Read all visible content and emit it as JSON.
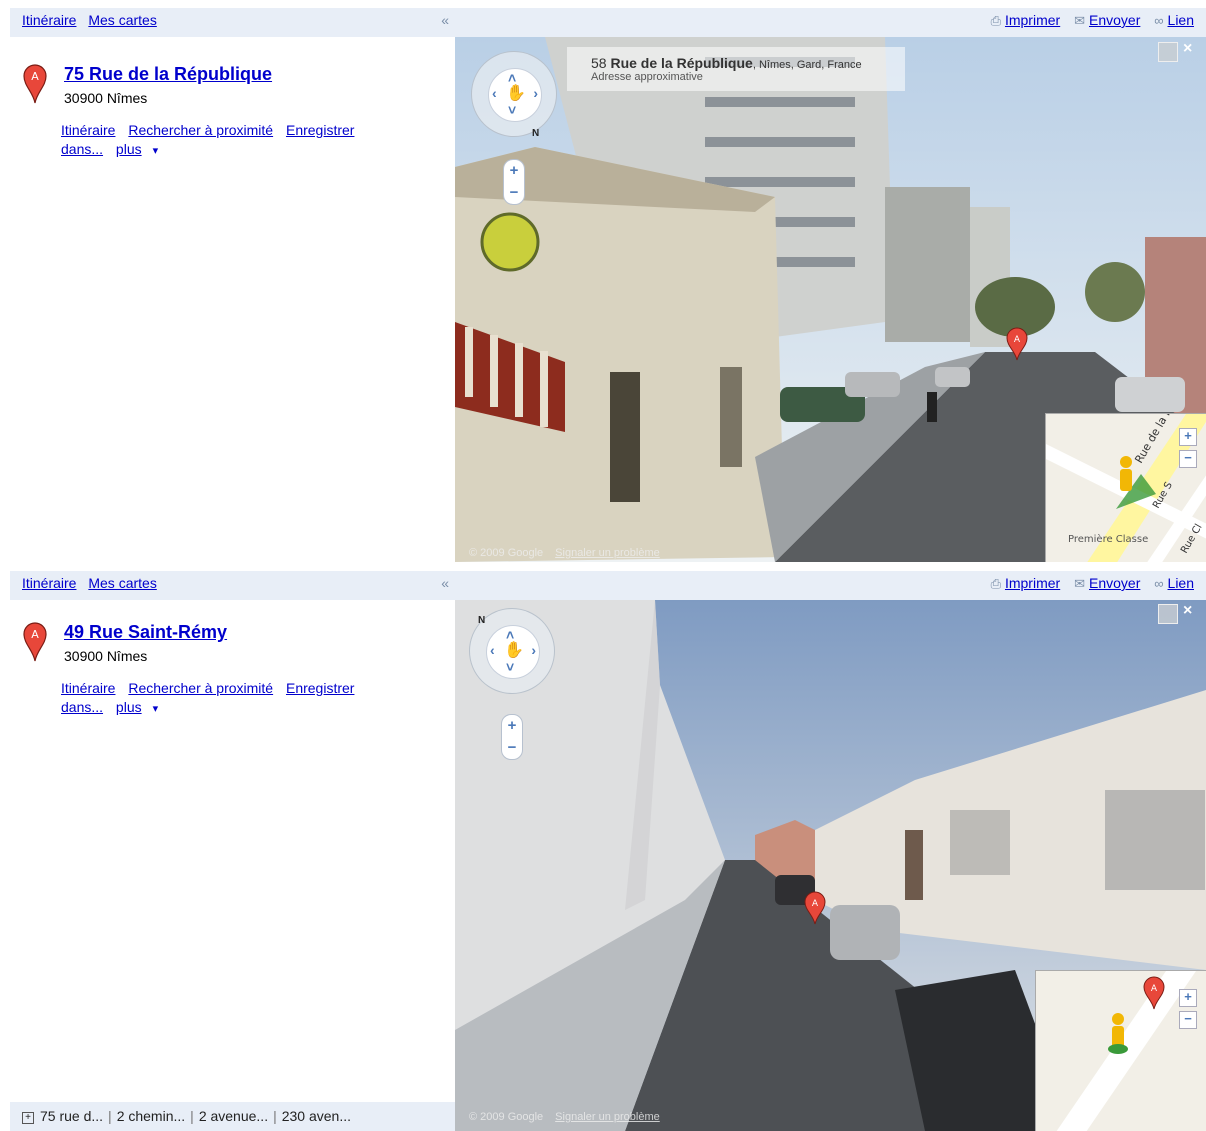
{
  "panels": [
    {
      "left_links": [
        "Itinéraire",
        "Mes cartes"
      ],
      "collapse": "«",
      "right_links": {
        "print": "Imprimer",
        "send": "Envoyer",
        "link": "Lien"
      },
      "result": {
        "pin_letter": "A",
        "title": "75 Rue de la République",
        "city": "30900 Nîmes",
        "actions": [
          "Itinéraire",
          "Rechercher à proximité",
          "Enregistrer dans...",
          "plus"
        ],
        "more_arrow": "▾"
      },
      "streetview": {
        "address_bold": "Rue de la République",
        "address_num": "58",
        "address_rest": ", Nîmes, Gard, France",
        "address_sub": "Adresse approximative",
        "copyright": "© 2009 Google",
        "report": "Signaler un problème",
        "nav_north": "N",
        "close": "×",
        "minimap_labels": [
          "Rue de la Rép",
          "Rue S",
          "Première Classe",
          "Rue Cl"
        ],
        "pin_letter": "A"
      }
    },
    {
      "left_links": [
        "Itinéraire",
        "Mes cartes"
      ],
      "collapse": "«",
      "right_links": {
        "print": "Imprimer",
        "send": "Envoyer",
        "link": "Lien"
      },
      "result": {
        "pin_letter": "A",
        "title": "49 Rue Saint-Rémy",
        "city": "30900 Nîmes",
        "actions": [
          "Itinéraire",
          "Rechercher à proximité",
          "Enregistrer dans...",
          "plus"
        ],
        "more_arrow": "▾"
      },
      "streetview": {
        "copyright": "© 2009 Google",
        "report": "Signaler un problème",
        "nav_north": "N",
        "close": "×",
        "pin_letter": "A"
      },
      "bottom_tabs": {
        "expand": "+",
        "items": [
          "75 rue d...",
          "2 chemin...",
          "2 avenue...",
          "230 aven..."
        ]
      }
    }
  ],
  "colors": {
    "link": "#0000cc",
    "toolbar_bg": "#e8eef7",
    "pin_red": "#e8473a"
  },
  "icons": [
    "printer-icon",
    "envelope-icon",
    "link-chain-icon",
    "map-pin-icon",
    "pegman-icon"
  ]
}
